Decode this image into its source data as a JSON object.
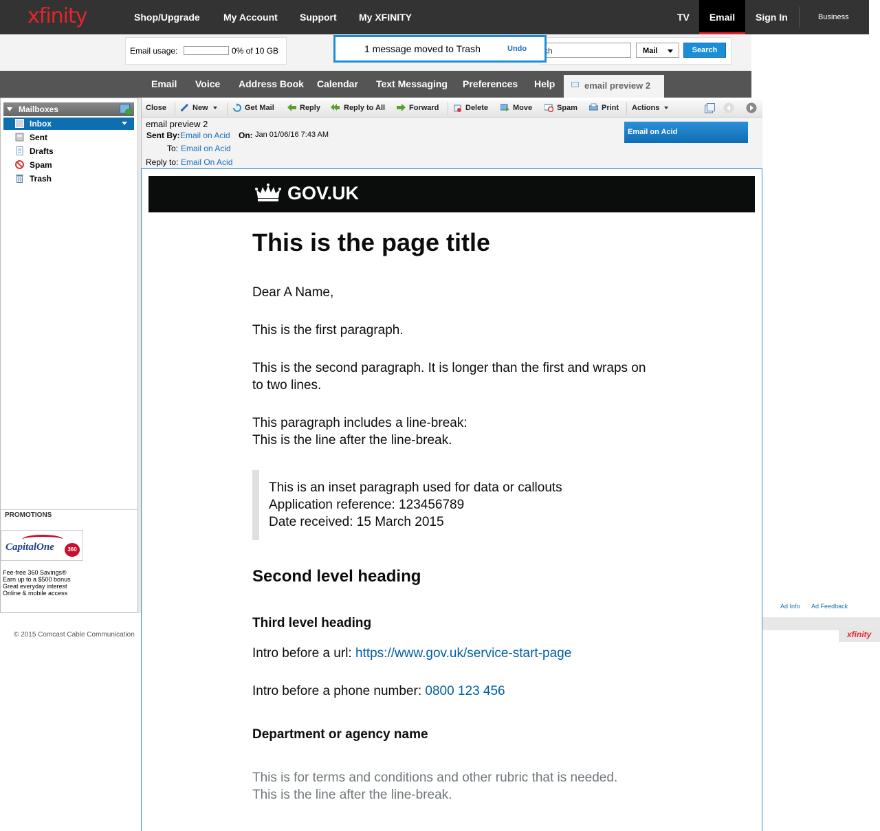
{
  "top_nav": {
    "logo": "xfinity",
    "items": [
      "Shop/Upgrade",
      "My Account",
      "Support",
      "My XFINITY"
    ],
    "right_items": [
      "TV",
      "Email",
      "Sign In"
    ],
    "business": "Business"
  },
  "usage": {
    "label": "Email usage:",
    "value": "0% of 10 GB",
    "percent": 0
  },
  "search": {
    "value": "ch",
    "scope": "Mail",
    "button": "Search"
  },
  "toast": {
    "message": "1 message moved to Trash",
    "undo": "Undo"
  },
  "tabs": {
    "items": [
      "Email",
      "Voice",
      "Address Book",
      "Calendar",
      "Text Messaging",
      "Preferences",
      "Help"
    ],
    "active": "email preview 2"
  },
  "sidebar": {
    "header": "Mailboxes",
    "folders": [
      "Inbox",
      "Sent",
      "Drafts",
      "Spam",
      "Trash"
    ],
    "promotions_title": "PROMOTIONS",
    "promo": {
      "brand": "CapitalOne",
      "badge": "360",
      "lines": [
        "Fee-free 360 Savings®",
        "Earn up to a $500 bonus",
        "Great everyday interest",
        "Online & mobile access"
      ]
    }
  },
  "toolbar": {
    "items": [
      "Close",
      "New",
      "Get Mail",
      "Reply",
      "Reply to All",
      "Forward",
      "Delete",
      "Move",
      "Spam",
      "Print",
      "Actions"
    ]
  },
  "message": {
    "subject": "email preview 2",
    "sent_by_label": "Sent By:",
    "sent_by": "Email on Acid",
    "on_label": "On:",
    "date": "Jan 01/06/16 7:43 AM",
    "to_label": "To:",
    "to": "Email on Acid",
    "reply_label": "Reply to:",
    "reply_to": "Email On Acid",
    "sender_badge": "Email on Acid"
  },
  "email": {
    "brand": "GOV.UK",
    "title": "This is the page title",
    "greeting": "Dear A Name,",
    "p1": "This is the first paragraph.",
    "p2_line1": "This is the second paragraph. It is longer than the first and wraps on",
    "p2_line2": "to two lines.",
    "p3_line1": "This paragraph includes a line-break:",
    "p3_line2": "This is the line after the line-break.",
    "inset_line1": "This is an inset paragraph used for data or callouts",
    "inset_line2": "Application reference: 123456789",
    "inset_line3": "Date received: 15 March 2015",
    "h2": "Second level heading",
    "h3": "Third level heading",
    "url_intro": "Intro before a url: ",
    "url": "https://www.gov.uk/service-start-page",
    "phone_intro": "Intro before a phone number: ",
    "phone": "0800 123 456",
    "department": "Department or agency name",
    "rubric_line1": "This is for terms and conditions and other rubric that is needed.",
    "rubric_line2": "This is the line after the line-break."
  },
  "ad_links": {
    "info": "Ad Info",
    "feedback": "Ad Feedback"
  },
  "footer": {
    "copyright": "© 2015 Comcast Cable Communication",
    "logo": "xfinity"
  },
  "colors": {
    "brand_red": "#e3262c",
    "link_blue": "#1a6ebb",
    "gov_link": "#005ea5",
    "selected_folder": "#0d6fb0"
  }
}
